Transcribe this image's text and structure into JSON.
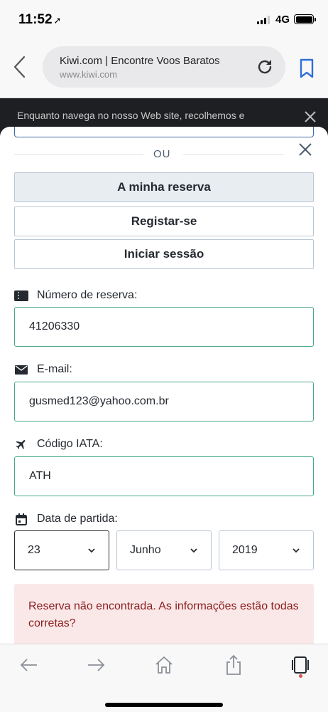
{
  "status_bar": {
    "time": "11:52",
    "location_glyph": "➚",
    "network": "4G",
    "icons": [
      "signal-icon",
      "battery-icon"
    ]
  },
  "browser": {
    "page_title": "Kiwi.com | Encontre Voos Baratos",
    "domain": "www.kiwi.com",
    "icons": [
      "back-icon",
      "reload-icon",
      "bookmark-icon"
    ]
  },
  "cookie_banner": {
    "text": "Enquanto navega no nosso Web site, recolhemos e"
  },
  "modal": {
    "or_text": "OU",
    "tabs": [
      {
        "label": "A minha reserva",
        "active": true
      },
      {
        "label": "Registar-se",
        "active": false
      },
      {
        "label": "Iniciar sessão",
        "active": false
      }
    ],
    "reservation": {
      "label": "Número de reserva:",
      "value": "41206330",
      "icon": "ticket-icon"
    },
    "email": {
      "label": "E-mail:",
      "value": "gusmed123@yahoo.com.br",
      "icon": "envelope-icon"
    },
    "iata": {
      "label": "Código IATA:",
      "value": "ATH",
      "icon": "airplane-icon"
    },
    "departure": {
      "label": "Data de partida:",
      "icon": "calendar-icon",
      "day": "23",
      "month": "Junho",
      "year": "2019"
    },
    "error": {
      "text": "Reserva não encontrada. As informações estão todas corretas?"
    },
    "colors": {
      "valid_border": "#48a98a",
      "error_bg": "#fae8e8",
      "error_text": "#8b1e1e",
      "active_tab_bg": "#e8edf1"
    }
  },
  "toolbar": {
    "icons": [
      "back-arrow-icon",
      "forward-arrow-icon",
      "home-icon",
      "share-icon",
      "tabs-icon"
    ]
  }
}
